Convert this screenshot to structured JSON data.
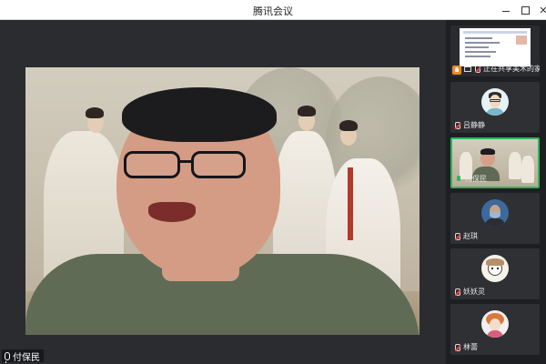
{
  "window": {
    "title": "腾讯会议",
    "controls": {
      "minimize": "minimize",
      "maximize": "maximize",
      "close": "✕"
    }
  },
  "main_video": {
    "speaker_name": "付保民",
    "mic_state": "on"
  },
  "participants": [
    {
      "name": "正在共享美术的家...",
      "kind": "screen-share",
      "mic_state": "muted",
      "active": false
    },
    {
      "name": "吕静静",
      "kind": "avatar",
      "mic_state": "muted",
      "active": false
    },
    {
      "name": "付保民",
      "kind": "video",
      "mic_state": "live",
      "active": true
    },
    {
      "name": "赵琪",
      "kind": "avatar",
      "mic_state": "muted",
      "active": false
    },
    {
      "name": "妖妖灵",
      "kind": "avatar",
      "mic_state": "muted",
      "active": false
    },
    {
      "name": "林蕾",
      "kind": "avatar",
      "mic_state": "muted",
      "active": false
    }
  ],
  "colors": {
    "active_border": "#2fb55a",
    "share_badge": "#f08a24",
    "muted_slash": "#e54848"
  }
}
